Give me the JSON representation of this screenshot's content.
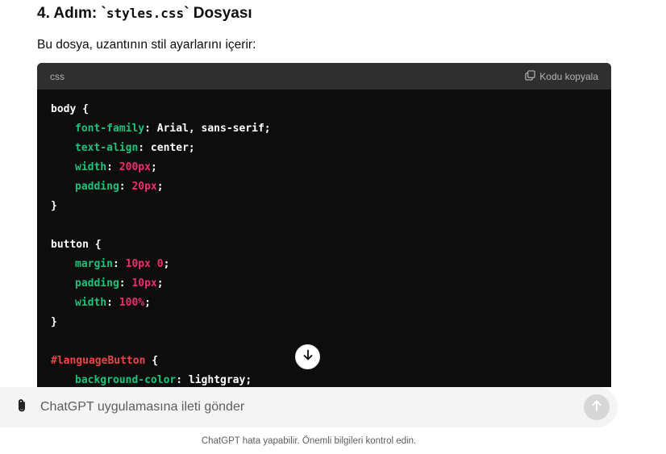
{
  "heading": {
    "prefix": "4. Adım: `",
    "code": "styles.css",
    "suffix": "` Dosyası"
  },
  "intro": "Bu dosya, uzantının stil ayarlarını içerir:",
  "codeblock": {
    "language": "css",
    "copy_label": "Kodu kopyala",
    "lines": [
      [
        {
          "t": "body {",
          "c": "plain"
        }
      ],
      [
        {
          "t": "font-family",
          "c": "prop",
          "i": 1
        },
        {
          "t": ": Arial, sans-serif;",
          "c": "plain"
        }
      ],
      [
        {
          "t": "text-align",
          "c": "prop",
          "i": 1
        },
        {
          "t": ": center;",
          "c": "plain"
        }
      ],
      [
        {
          "t": "width",
          "c": "prop",
          "i": 1
        },
        {
          "t": ": ",
          "c": "plain"
        },
        {
          "t": "200px",
          "c": "num"
        },
        {
          "t": ";",
          "c": "plain"
        }
      ],
      [
        {
          "t": "padding",
          "c": "prop",
          "i": 1
        },
        {
          "t": ": ",
          "c": "plain"
        },
        {
          "t": "20px",
          "c": "num"
        },
        {
          "t": ";",
          "c": "plain"
        }
      ],
      [
        {
          "t": "}",
          "c": "plain"
        }
      ],
      [],
      [
        {
          "t": "button {",
          "c": "plain"
        }
      ],
      [
        {
          "t": "margin",
          "c": "prop",
          "i": 1
        },
        {
          "t": ": ",
          "c": "plain"
        },
        {
          "t": "10px 0",
          "c": "num"
        },
        {
          "t": ";",
          "c": "plain"
        }
      ],
      [
        {
          "t": "padding",
          "c": "prop",
          "i": 1
        },
        {
          "t": ": ",
          "c": "plain"
        },
        {
          "t": "10px",
          "c": "num"
        },
        {
          "t": ";",
          "c": "plain"
        }
      ],
      [
        {
          "t": "width",
          "c": "prop",
          "i": 1
        },
        {
          "t": ": ",
          "c": "plain"
        },
        {
          "t": "100%",
          "c": "num"
        },
        {
          "t": ";",
          "c": "plain"
        }
      ],
      [
        {
          "t": "}",
          "c": "plain"
        }
      ],
      [],
      [
        {
          "t": "#languageButton",
          "c": "sel"
        },
        {
          "t": " {",
          "c": "plain"
        }
      ],
      [
        {
          "t": "background-color",
          "c": "prop",
          "i": 1
        },
        {
          "t": ": lightgray;",
          "c": "plain"
        }
      ]
    ]
  },
  "composer": {
    "placeholder": "ChatGPT uygulamasına ileti gönder",
    "attach_icon": "paperclip-icon",
    "send_icon": "arrow-up-icon"
  },
  "scroll_icon": "arrow-down-icon",
  "disclaimer": "ChatGPT hata yapabilir. Önemli bilgileri kontrol edin.",
  "colors": {
    "prop": "#19c37d",
    "num": "#e9306c",
    "selector": "#ef4444",
    "code_bg": "#0d0d0d",
    "header_bg": "#2f2f2f"
  }
}
